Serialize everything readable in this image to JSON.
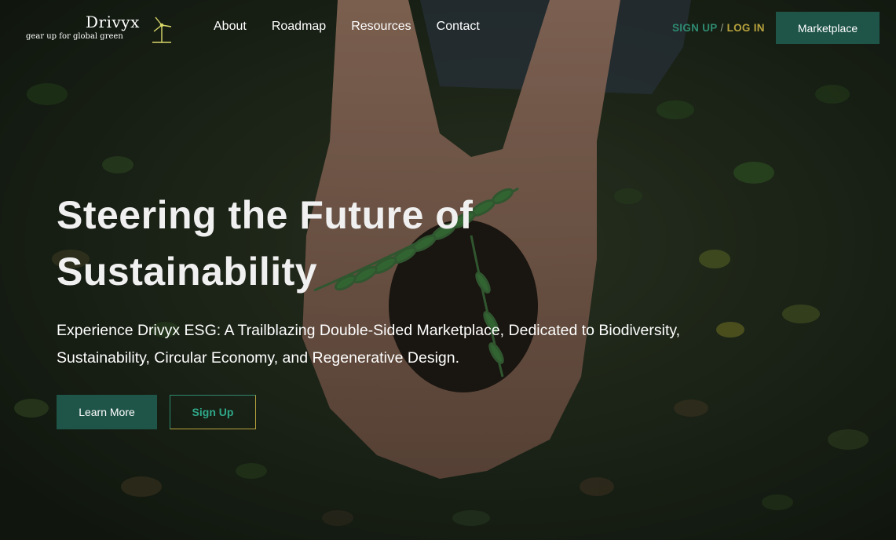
{
  "brand": {
    "name": "Drivyx",
    "tagline": "gear up for global green",
    "logo_icon": "wind-turbine-icon"
  },
  "nav": {
    "items": [
      {
        "label": "About"
      },
      {
        "label": "Roadmap"
      },
      {
        "label": "Resources"
      },
      {
        "label": "Contact"
      }
    ]
  },
  "auth": {
    "signup_label": "SIGN UP",
    "separator": "/",
    "login_label": "LOG IN"
  },
  "marketplace_label": "Marketplace",
  "hero": {
    "headline": "Steering the Future of Sustainability",
    "subheadline": "Experience Drivyx ESG: A Trailblazing Double-Sided Marketplace, Dedicated to Biodiversity, Sustainability, Circular Economy, and Regenerative Design.",
    "learn_more_label": "Learn More",
    "signup_label": "Sign Up",
    "background_image": "hands-holding-soil-with-seedling"
  },
  "colors": {
    "primary_button": "#1f5448",
    "signup_accent": "#2e8a71",
    "login_accent": "#b7a23d",
    "text": "#ffffff"
  }
}
